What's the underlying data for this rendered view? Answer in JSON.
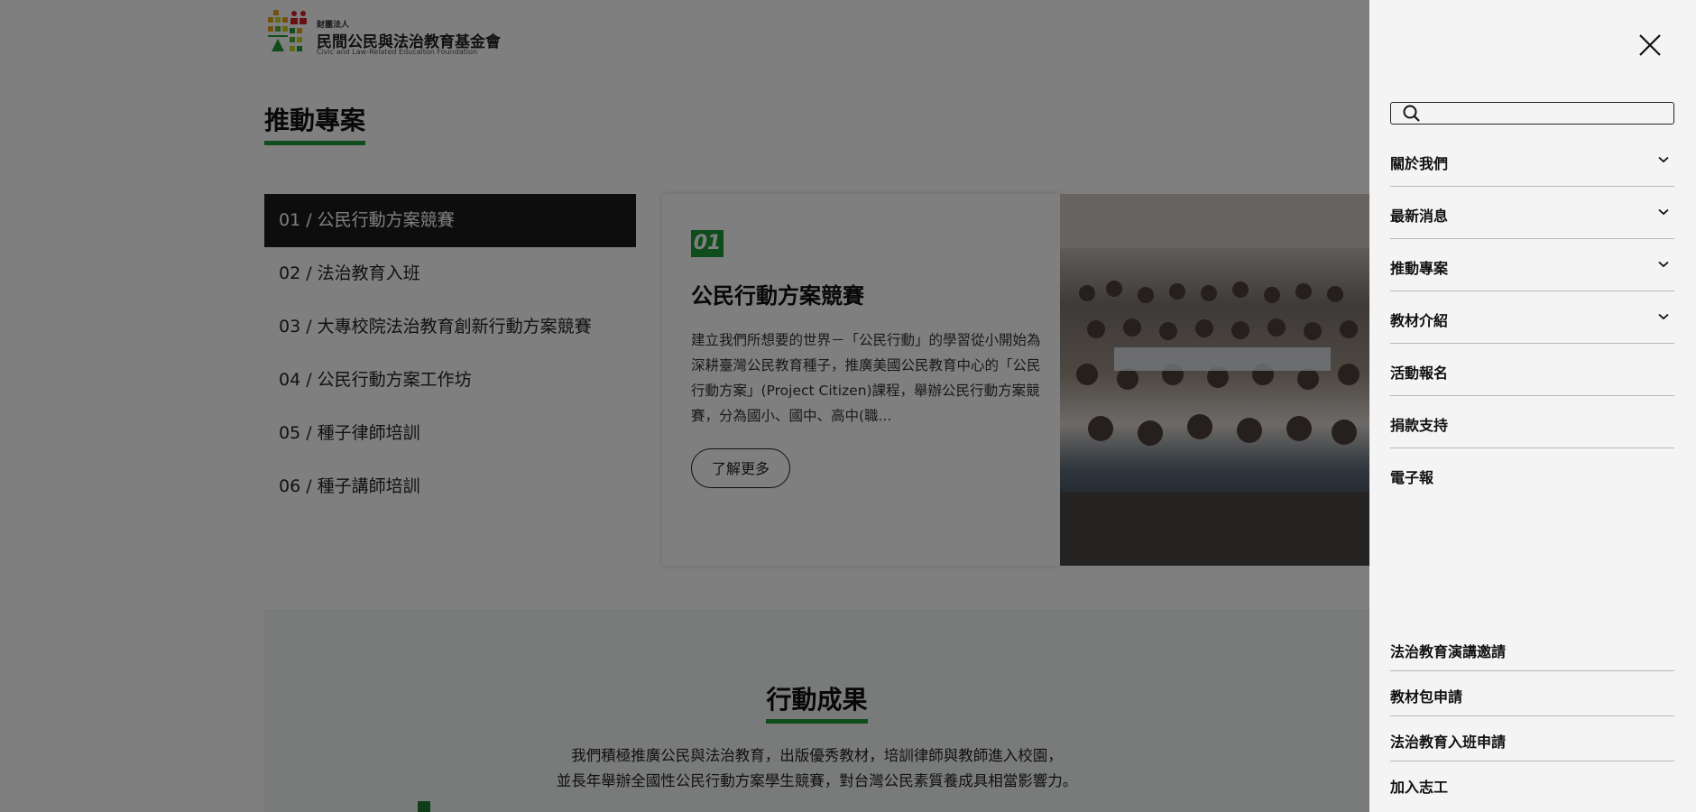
{
  "header": {
    "logo_small": "財團法人",
    "logo_name": "民間公民與法治教育基金會",
    "logo_en": "Civic and Law-Related Educaiton Foundation"
  },
  "projects": {
    "title": "推動專案",
    "items": [
      {
        "label": "01 / 公民行動方案競賽"
      },
      {
        "label": "02 / 法治教育入班"
      },
      {
        "label": "03 / 大專校院法治教育創新行動方案競賽"
      },
      {
        "label": "04 / 公民行動方案工作坊"
      },
      {
        "label": "05 / 種子律師培訓"
      },
      {
        "label": "06 / 種子講師培訓"
      }
    ],
    "card": {
      "number": "01",
      "title": "公民行動方案競賽",
      "description": "建立我們所想要的世界－「公民行動」的學習從小開始為深耕臺灣公民教育種子，推廣美國公民教育中心的「公民行動方案」(Project Citizen)課程，舉辦公民行動方案競賽，分為國小、國中、高中(職...",
      "button": "了解更多"
    }
  },
  "results": {
    "title": "行動成果",
    "line1": "我們積極推廣公民與法治教育，出版優秀教材，培訓律師與教師進入校園，",
    "line2": "並長年舉辦全國性公民行動方案學生競賽，對台灣公民素質養成具相當影響力。"
  },
  "drawer": {
    "search_placeholder": "",
    "menu": [
      {
        "label": "關於我們",
        "has_submenu": true
      },
      {
        "label": "最新消息",
        "has_submenu": true
      },
      {
        "label": "推動專案",
        "has_submenu": true
      },
      {
        "label": "教材介紹",
        "has_submenu": true
      },
      {
        "label": "活動報名",
        "has_submenu": false
      },
      {
        "label": "捐款支持",
        "has_submenu": false
      },
      {
        "label": "電子報",
        "has_submenu": false
      }
    ],
    "links": [
      {
        "label": "法治教育演講邀請"
      },
      {
        "label": "教材包申請"
      },
      {
        "label": "法治教育入班申請"
      },
      {
        "label": "加入志工"
      }
    ]
  },
  "colors": {
    "accent": "#1e9b3a",
    "overlay": "rgba(0,0,0,0.5)",
    "drawer_bg": "#f4f4f4"
  }
}
